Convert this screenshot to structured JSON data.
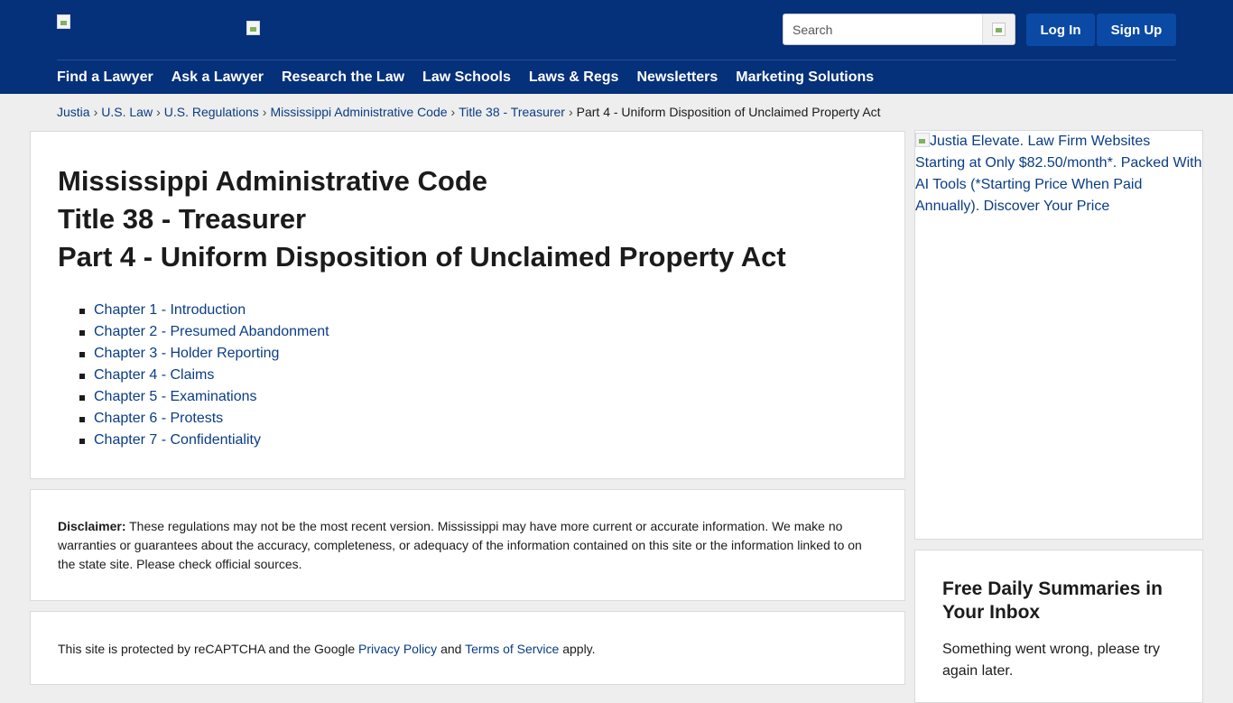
{
  "header": {
    "search_placeholder": "Search",
    "login_label": "Log In",
    "signup_label": "Sign Up",
    "nav": [
      "Find a Lawyer",
      "Ask a Lawyer",
      "Research the Law",
      "Law Schools",
      "Laws & Regs",
      "Newsletters",
      "Marketing Solutions"
    ]
  },
  "breadcrumb": {
    "items": [
      "Justia",
      "U.S. Law",
      "U.S. Regulations",
      "Mississippi Administrative Code",
      "Title 38 - Treasurer"
    ],
    "current": "Part 4 - Uniform Disposition of Unclaimed Property Act",
    "separator": "›"
  },
  "main": {
    "title_lines": [
      "Mississippi Administrative Code",
      "Title 38 - Treasurer",
      "Part 4 - Uniform Disposition of Unclaimed Property Act"
    ],
    "chapters": [
      "Chapter 1 - Introduction",
      "Chapter 2 - Presumed Abandonment",
      "Chapter 3 - Holder Reporting",
      "Chapter 4 - Claims",
      "Chapter 5 - Examinations",
      "Chapter 6 - Protests",
      "Chapter 7 - Confidentiality"
    ]
  },
  "disclaimer": {
    "label": "Disclaimer:",
    "text": " These regulations may not be the most recent version. Mississippi may have more current or accurate information. We make no warranties or guarantees about the accuracy, completeness, or adequacy of the information contained on this site or the information linked to on the state site. Please check official sources."
  },
  "recaptcha": {
    "prefix": "This site is protected by reCAPTCHA and the Google ",
    "privacy_link": "Privacy Policy",
    "and": " and ",
    "terms_link": "Terms of Service",
    "suffix": " apply."
  },
  "sidebar": {
    "ad_alt": "Justia Elevate. Law Firm Websites Starting at Only $82.50/month*. Packed With AI Tools (*Starting Price When Paid Annually). Discover Your Price",
    "newsletter_title": "Free Daily Summaries in Your Inbox",
    "newsletter_message": "Something went wrong, please try again later."
  },
  "colors": {
    "header_bg": "#05307a",
    "button_bg": "#0a4aa5",
    "link": "#0a3d84",
    "page_bg": "#eeeeee"
  }
}
